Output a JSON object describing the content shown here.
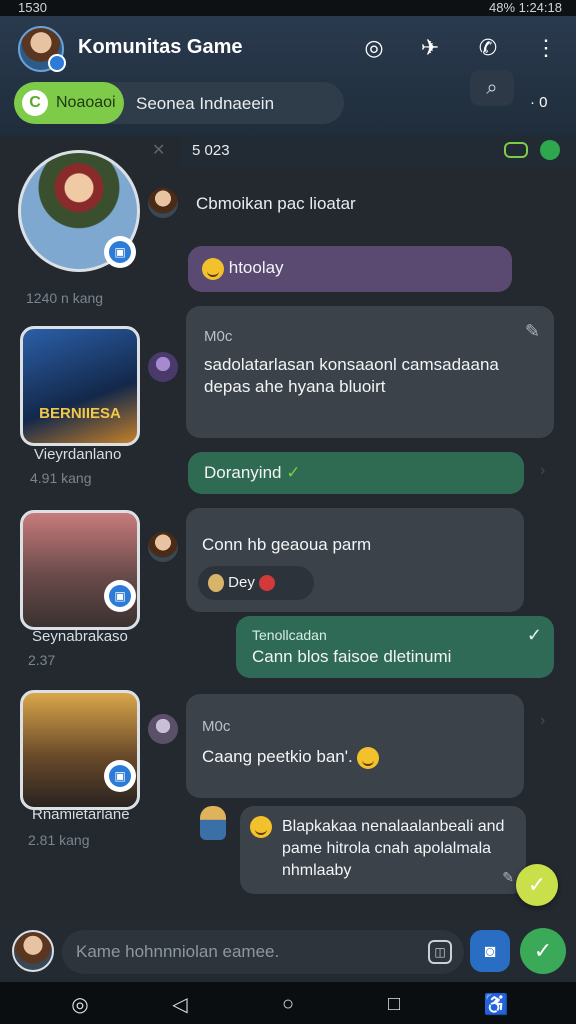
{
  "status": {
    "time": "1530",
    "right": "48% 1:24:18"
  },
  "header": {
    "title": "Komunitas Game"
  },
  "search": {
    "chip_label": "Noaoaoi",
    "chip_icon_text": "C",
    "text": "Seonea Indnaeein",
    "dot_text": "· 0"
  },
  "subbar": {
    "text": "5 023"
  },
  "sidebar": {
    "items": [
      {
        "label": "",
        "sub": "1240 n kang"
      },
      {
        "label": "Vieyrdanlano",
        "sub": "4.91 kang",
        "art": "BERNIIESA"
      },
      {
        "label": "Seynabrakaso",
        "sub": "2.37"
      },
      {
        "label": "Rnamietarlane",
        "sub": "2.81 kang"
      }
    ]
  },
  "messages": {
    "m1": "Cbmoikan pac lioatar",
    "m2": "htoolay",
    "m3_author": "M0c",
    "m3_text": "sadolatarlasan konsaaonl camsadaana depas ahe hyana bluoirt",
    "m4": "Doranyind",
    "m5_text": "Conn hb geaoua parm",
    "m5_reaction": "Dey",
    "m6_author": "Tenollcadan",
    "m6_text": "Cann blos faisoe dletinumi",
    "m7_author": "M0c",
    "m7_text": "Caang peetkio ban'.",
    "m8_text": "Blapkakaa nenalaalanbeali and pame hitrola cnah apolalmala nhmlaaby"
  },
  "composer": {
    "placeholder": "Kame hohnnniolan eamee."
  },
  "colors": {
    "accent_green": "#7ecb4a",
    "header": "#2a3a4e",
    "bubble_purple": "#5a4a72",
    "bubble_green": "#2f6a52"
  }
}
